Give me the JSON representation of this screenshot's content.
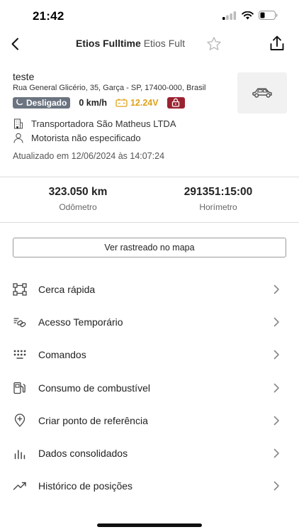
{
  "status_bar": {
    "time": "21:42"
  },
  "nav": {
    "title_bold": "Etios Fulltime",
    "title_light": "Etios Fult"
  },
  "vehicle": {
    "name": "teste",
    "address": "Rua General Glicério, 35, Garça - SP, 17400-000, Brasil",
    "ignition_status": "Desligado",
    "speed": "0 km/h",
    "voltage": "12.24V",
    "company": "Transportadora São Matheus LTDA",
    "driver": "Motorista não especificado",
    "updated": "Atualizado em 12/06/2024 às 14:07:24"
  },
  "metrics": {
    "odometer_value": "323.050 km",
    "odometer_label": "Odômetro",
    "hourmeter_value": "291351:15:00",
    "hourmeter_label": "Horímetro"
  },
  "map_button_label": "Ver rastreado no mapa",
  "menu": [
    {
      "label": "Cerca rápida",
      "icon": "fence-icon"
    },
    {
      "label": "Acesso Temporário",
      "icon": "link-icon"
    },
    {
      "label": "Comandos",
      "icon": "keypad-icon"
    },
    {
      "label": "Consumo de combustível",
      "icon": "fuel-icon"
    },
    {
      "label": "Criar ponto de referência",
      "icon": "add-location-icon"
    },
    {
      "label": "Dados consolidados",
      "icon": "bar-chart-icon"
    },
    {
      "label": "Histórico de posições",
      "icon": "trending-icon"
    }
  ],
  "colors": {
    "badge_off": "#6b7480",
    "voltage": "#e0a21b",
    "lock": "#9b2230"
  }
}
